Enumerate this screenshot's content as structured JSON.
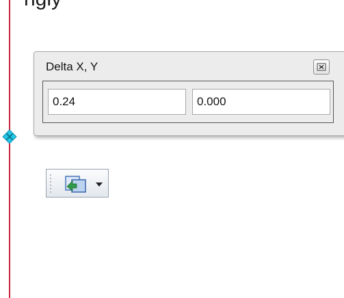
{
  "background_text": "ngly",
  "dialog": {
    "title": "Delta X, Y",
    "delta_x": "0.24",
    "delta_y": "0.000"
  },
  "icons": {
    "close": "close-icon",
    "snap": "snap-point-icon",
    "tool": "tool-icon",
    "dropdown": "chevron-down-icon"
  },
  "colors": {
    "guide_line": "#c8243c",
    "snap_marker": "#22c8e6",
    "panel_bg": "#ececec"
  }
}
